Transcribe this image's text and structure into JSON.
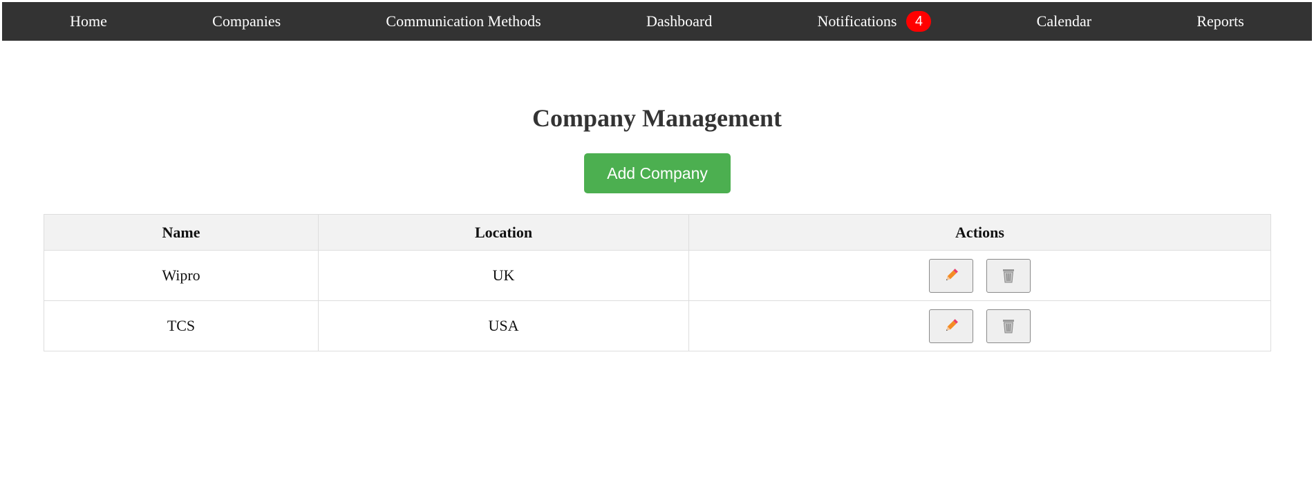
{
  "nav": {
    "items": [
      {
        "label": "Home"
      },
      {
        "label": "Companies"
      },
      {
        "label": "Communication Methods"
      },
      {
        "label": "Dashboard"
      },
      {
        "label": "Notifications",
        "badge": "4"
      },
      {
        "label": "Calendar"
      },
      {
        "label": "Reports"
      }
    ]
  },
  "page": {
    "title": "Company Management",
    "add_button": "Add Company"
  },
  "table": {
    "headers": [
      "Name",
      "Location",
      "Actions"
    ],
    "rows": [
      {
        "name": "Wipro",
        "location": "UK",
        "actions": [
          "pencil-icon",
          "wastebasket-icon"
        ]
      },
      {
        "name": "TCS",
        "location": "USA",
        "actions": [
          "pencil-icon",
          "wastebasket-icon"
        ]
      }
    ]
  },
  "colors": {
    "navbar_bg": "#333333",
    "badge_bg": "#ff0000",
    "add_button_bg": "#4caf50",
    "table_header_bg": "#f2f2f2",
    "pencil_color": "#f48c24"
  }
}
